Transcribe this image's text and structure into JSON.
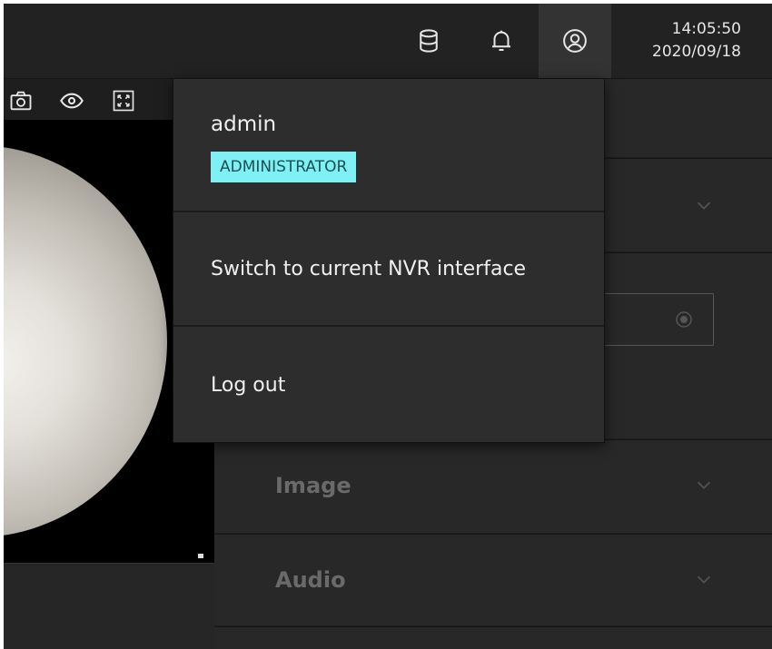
{
  "header": {
    "time": "14:05:50",
    "date": "2020/09/18",
    "icons": [
      "database-icon",
      "bell-icon",
      "user-icon"
    ]
  },
  "video_toolbar": {
    "icons": [
      "camera-icon",
      "eye-icon",
      "fullscreen-icon"
    ]
  },
  "settings": {
    "rows": [
      {
        "label": "Image"
      },
      {
        "label": "Audio"
      }
    ]
  },
  "user_menu": {
    "username": "admin",
    "role": "ADMINISTRATOR",
    "items": [
      {
        "label": "Switch to current NVR interface"
      },
      {
        "label": "Log out"
      }
    ]
  },
  "colors": {
    "badge": "#7ff0f3",
    "badge_text": "#1d4f55",
    "menu_bg": "#2d2d2d",
    "header_bg": "#222222"
  }
}
